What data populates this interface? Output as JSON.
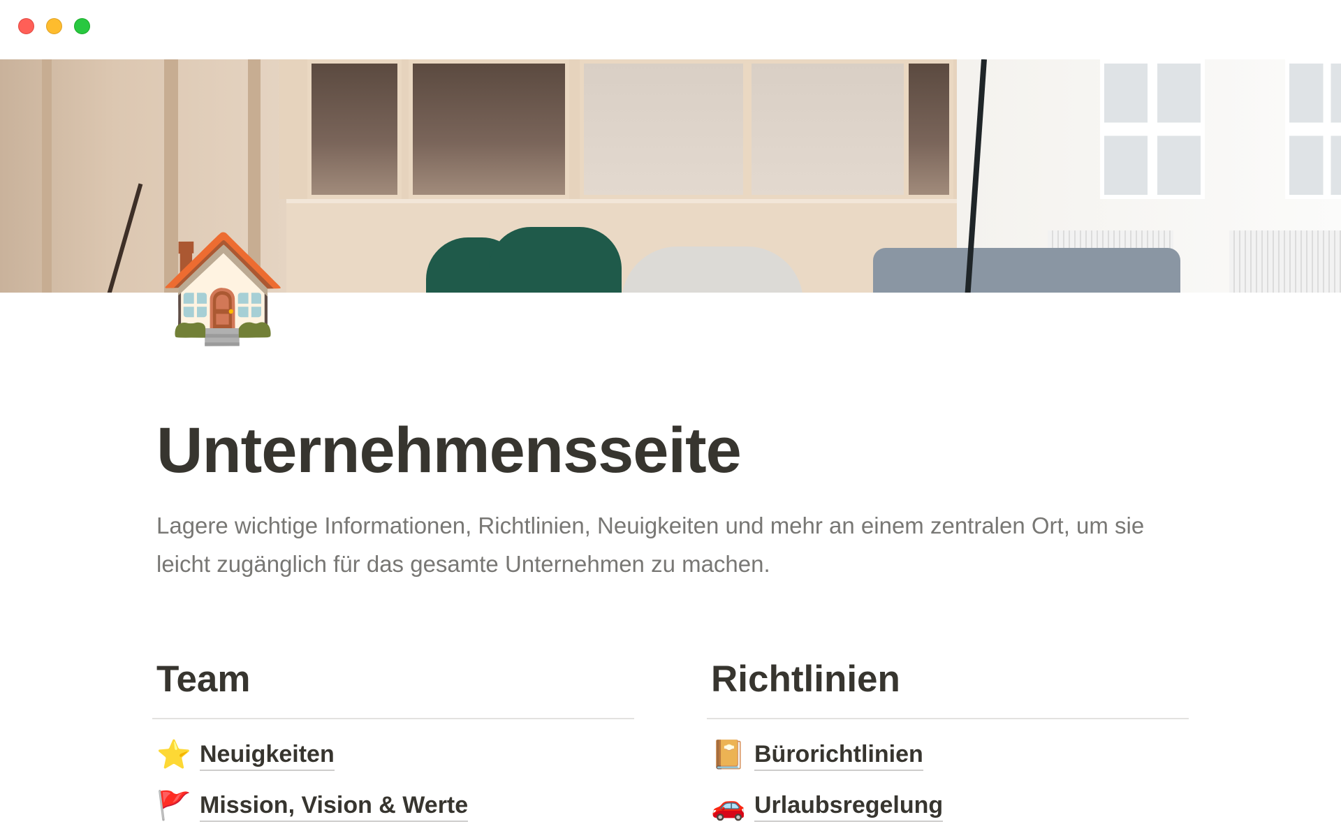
{
  "page": {
    "icon": "🏠",
    "title": "Unternehmensseite",
    "description": "Lagere wichtige Informationen, Richtlinien, Neuigkeiten und mehr an einem zentralen Ort, um sie leicht zugänglich für das gesamte Unternehmen zu machen."
  },
  "columns": [
    {
      "heading": "Team",
      "links": [
        {
          "icon": "⭐",
          "label": "Neuigkeiten"
        },
        {
          "icon": "🚩",
          "label": "Mission, Vision & Werte"
        }
      ]
    },
    {
      "heading": "Richtlinien",
      "links": [
        {
          "icon": "📔",
          "label": "Bürorichtlinien"
        },
        {
          "icon": "🚗",
          "label": "Urlaubsregelung"
        }
      ]
    }
  ],
  "colors": {
    "text": "#37352f",
    "muted": "#787774",
    "divider": "#e3e2e0",
    "traffic_close": "#ff5f57",
    "traffic_minimize": "#febc2e",
    "traffic_zoom": "#28c840"
  }
}
